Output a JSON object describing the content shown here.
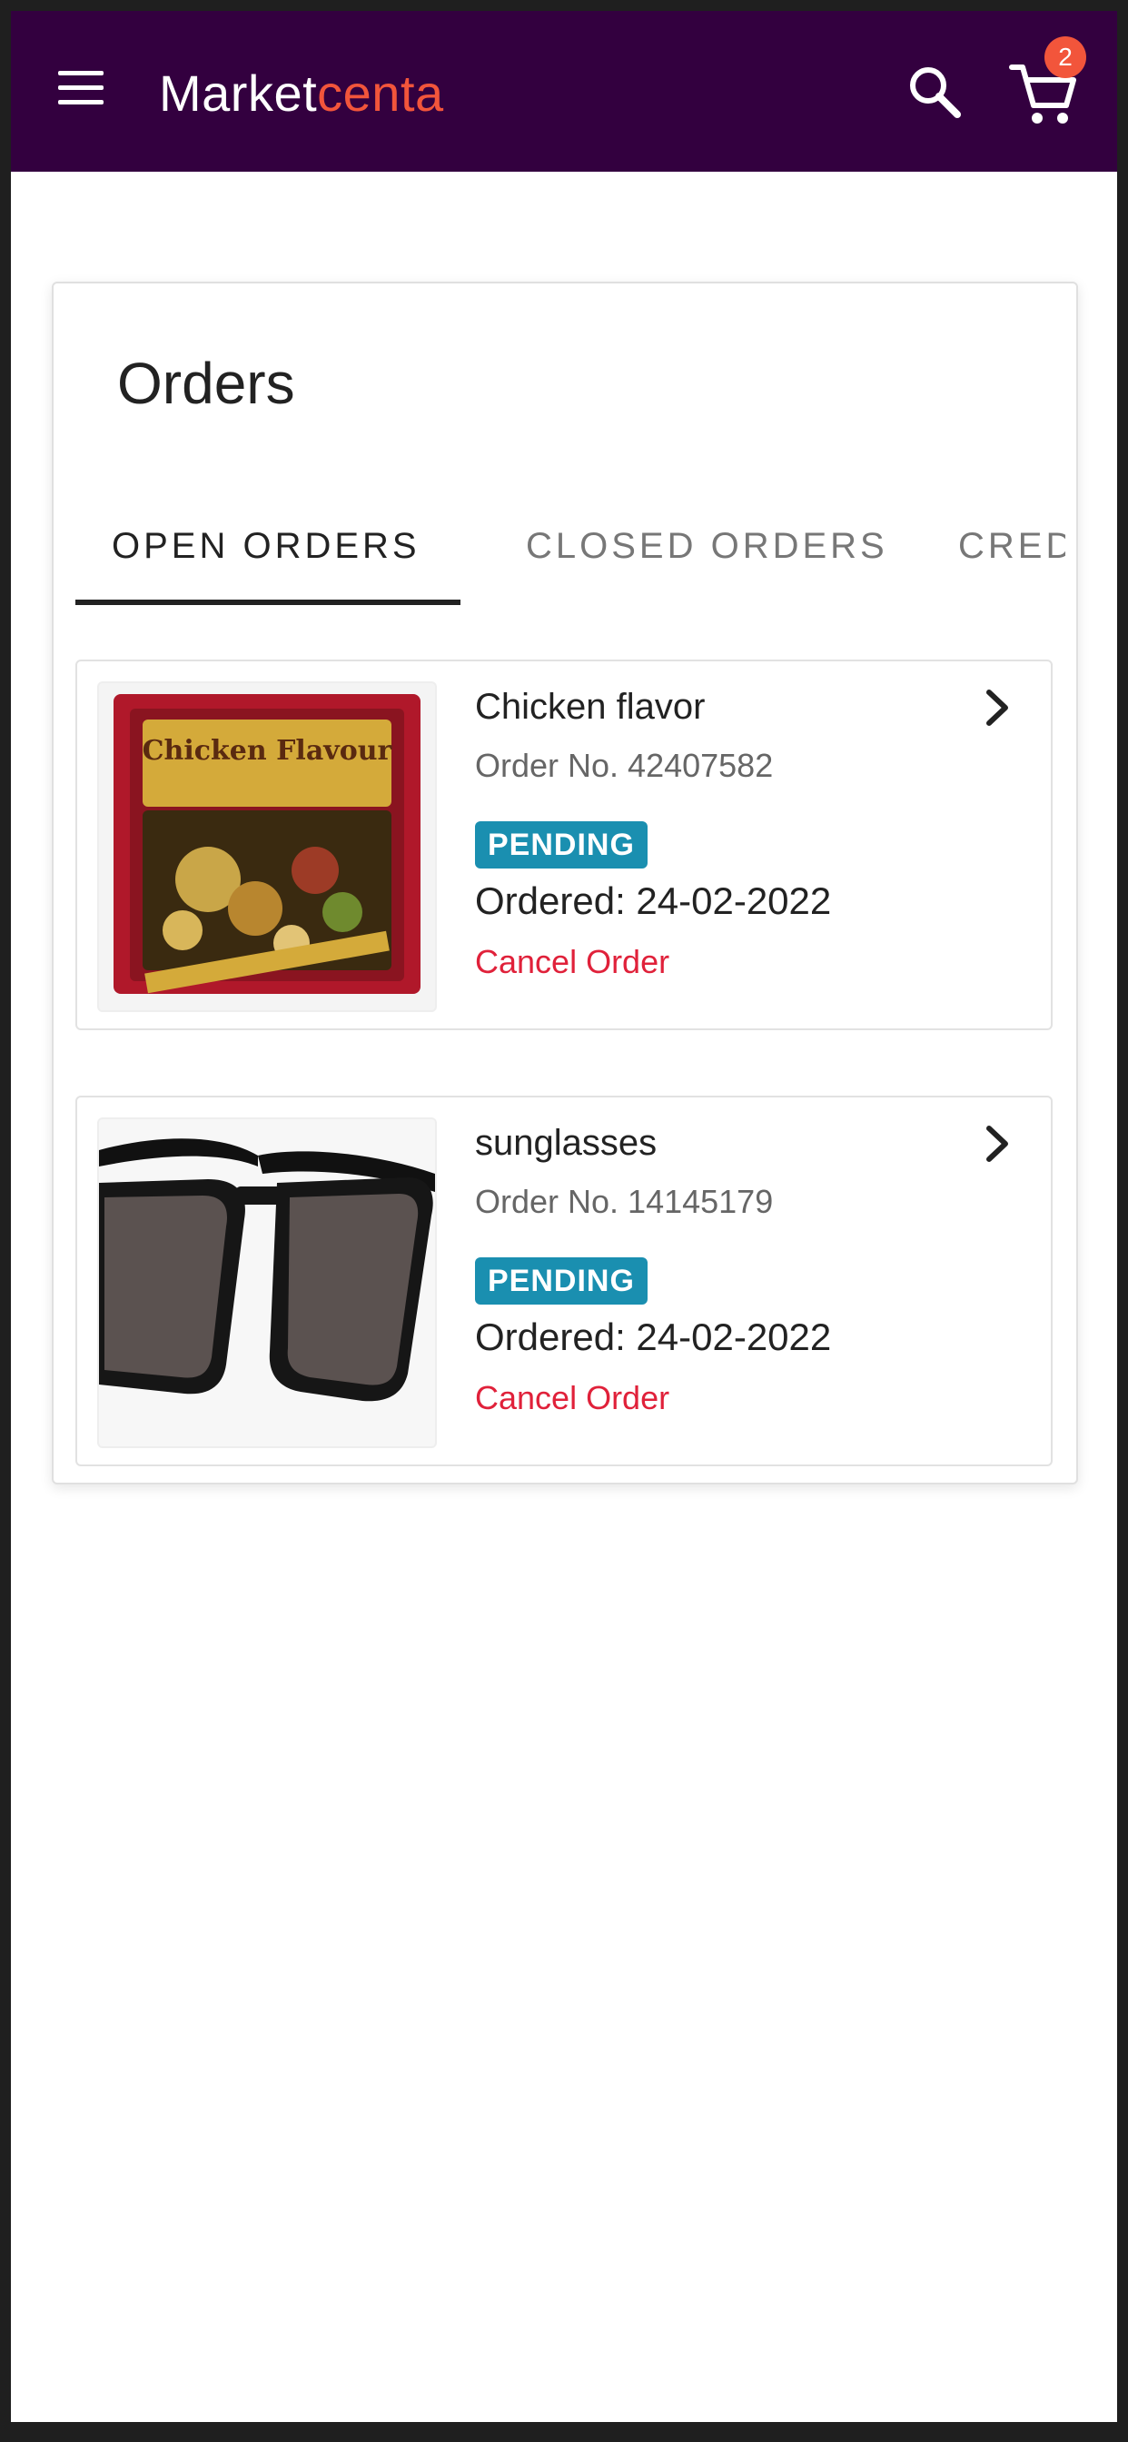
{
  "app": {
    "brand_primary": "Market",
    "brand_accent": "centa",
    "cart_count": "2",
    "colors": {
      "appbar": "#33003f",
      "brand_accent": "#f2553b",
      "status_badge": "#1a8fb0",
      "cancel_link": "#e0213a"
    },
    "icons": [
      "menu-icon",
      "search-icon",
      "cart-icon",
      "chevron-right-icon"
    ]
  },
  "page": {
    "title": "Orders"
  },
  "tabs": [
    {
      "label": "OPEN ORDERS",
      "active": true
    },
    {
      "label": "CLOSED ORDERS",
      "active": false
    },
    {
      "label": "CRED",
      "active": false
    }
  ],
  "orders": [
    {
      "name": "Chicken flavor",
      "order_no": "Order No. 42407582",
      "status": "PENDING",
      "ordered": "Ordered: 24-02-2022",
      "cancel_label": "Cancel Order",
      "image_label": "Chicken Flavour"
    },
    {
      "name": "sunglasses",
      "order_no": "Order No. 14145179",
      "status": "PENDING",
      "ordered": "Ordered: 24-02-2022",
      "cancel_label": "Cancel Order",
      "image_label": ""
    }
  ]
}
